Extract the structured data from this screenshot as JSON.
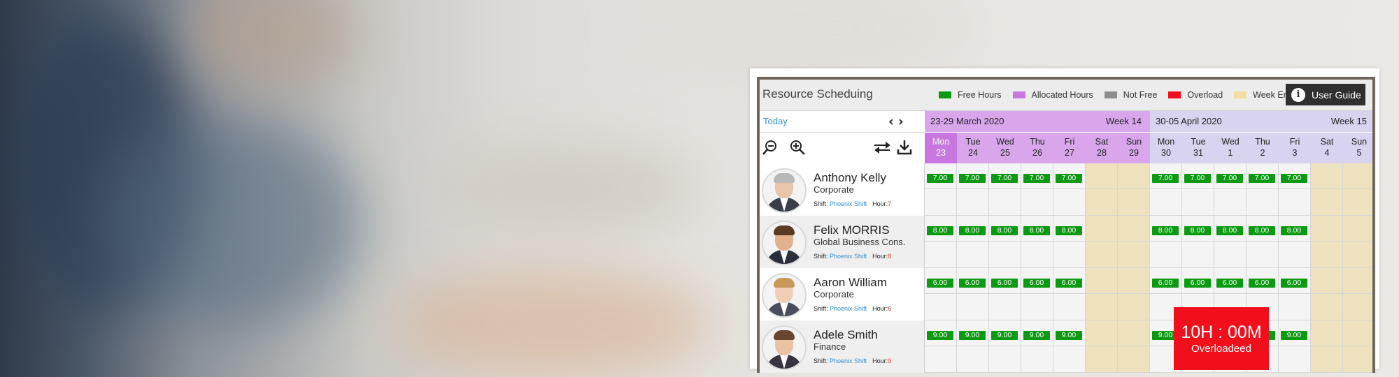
{
  "app": {
    "title": "Resource Scheduing",
    "user_guide_label": "User Guide",
    "today_label": "Today"
  },
  "legend": [
    {
      "label": "Free Hours",
      "color": "#0c9a12"
    },
    {
      "label": "Allocated Hours",
      "color": "#c977e0"
    },
    {
      "label": "Not Free",
      "color": "#8e8e8e"
    },
    {
      "label": "Overload",
      "color": "#f20f1c"
    },
    {
      "label": "Week End",
      "color": "#f4dfa0"
    }
  ],
  "icons": {
    "prev": "chevron-left-icon",
    "next": "chevron-right-icon",
    "zoom_out": "zoom-out-icon",
    "zoom_in": "zoom-in-icon",
    "swap": "swap-arrows-icon",
    "download": "download-icon",
    "info": "info-icon"
  },
  "weeks": [
    {
      "range": "23-29 March 2020",
      "week": "Week 14",
      "color": "#d9a6ec"
    },
    {
      "range": "30-05 April 2020",
      "week": "Week 15",
      "color": "#d8d3ef"
    }
  ],
  "days": [
    {
      "name": "Mon",
      "num": "23",
      "weekend": false,
      "today": true
    },
    {
      "name": "Tue",
      "num": "24",
      "weekend": false,
      "today": false
    },
    {
      "name": "Wed",
      "num": "25",
      "weekend": false,
      "today": false
    },
    {
      "name": "Thu",
      "num": "26",
      "weekend": false,
      "today": false
    },
    {
      "name": "Fri",
      "num": "27",
      "weekend": false,
      "today": false
    },
    {
      "name": "Sat",
      "num": "28",
      "weekend": true,
      "today": false
    },
    {
      "name": "Sun",
      "num": "29",
      "weekend": true,
      "today": false
    },
    {
      "name": "Mon",
      "num": "30",
      "weekend": false,
      "today": false
    },
    {
      "name": "Tue",
      "num": "31",
      "weekend": false,
      "today": false
    },
    {
      "name": "Wed",
      "num": "1",
      "weekend": false,
      "today": false
    },
    {
      "name": "Thu",
      "num": "2",
      "weekend": false,
      "today": false
    },
    {
      "name": "Fri",
      "num": "3",
      "weekend": false,
      "today": false
    },
    {
      "name": "Sat",
      "num": "4",
      "weekend": true,
      "today": false
    },
    {
      "name": "Sun",
      "num": "5",
      "weekend": true,
      "today": false
    }
  ],
  "shift_prefix": "Shift:",
  "hour_prefix": "Hour:",
  "people": [
    {
      "name": "Anthony Kelly",
      "dept": "Corporate",
      "shift": "Phoenix Shift",
      "hour": "7",
      "free": "7.00",
      "hair": "#b8b8b8",
      "skin": "#e8c4a8",
      "suit": "#3a3e48"
    },
    {
      "name": "Felix MORRIS",
      "dept": "Global Business Cons.",
      "shift": "Phoenix Shift",
      "hour": "8",
      "free": "8.00",
      "hair": "#5a3a22",
      "skin": "#e2b08c",
      "suit": "#2a2f3a"
    },
    {
      "name": "Aaron William",
      "dept": "Corporate",
      "shift": "Phoenix Shift",
      "hour": "6",
      "free": "6.00",
      "hair": "#c89a5a",
      "skin": "#f0cfb6",
      "suit": "#4a4e5a"
    },
    {
      "name": "Adele Smith",
      "dept": "Finance",
      "shift": "Phoenix Shift",
      "hour": "9",
      "free": "9.00",
      "hair": "#6a4530",
      "skin": "#eac2a4",
      "suit": "#3a3340"
    }
  ],
  "overload": {
    "time": "10H : 00M",
    "label": "Overloadeed"
  }
}
